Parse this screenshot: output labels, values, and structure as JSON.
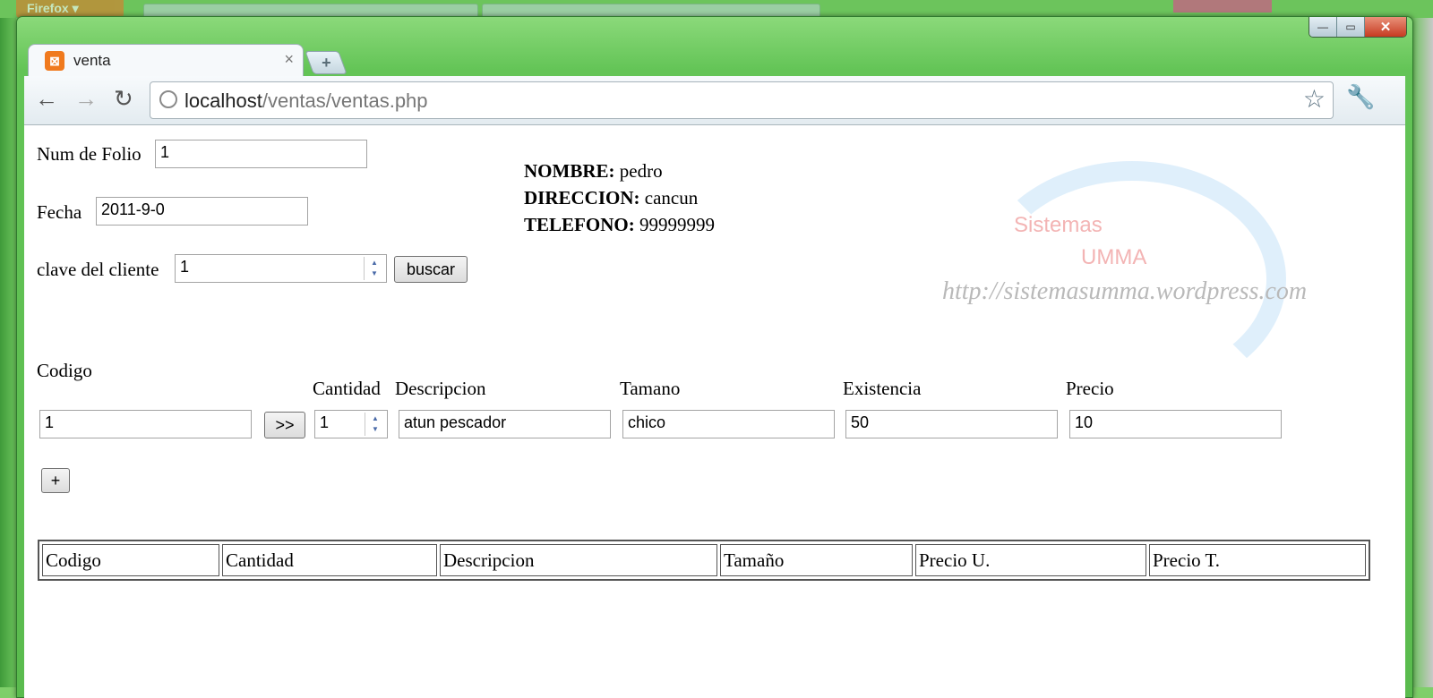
{
  "browser": {
    "tab_title": "venta",
    "tab_close": "×",
    "new_tab": "+",
    "url_host": "localhost",
    "url_path": "/ventas/ventas.php",
    "back": "←",
    "forward": "→",
    "reload": "↻",
    "star": "☆",
    "wrench": "🔧",
    "minimize": "—",
    "maximize": "▭",
    "close": "✕",
    "bg_firefox_label": "Firefox ▾"
  },
  "form": {
    "folio_label": "Num de Folio",
    "folio_value": "1",
    "fecha_label": "Fecha",
    "fecha_value": "2011-9-0",
    "clave_label": "clave del cliente",
    "clave_value": "1",
    "buscar_label": "buscar"
  },
  "cliente": {
    "nombre_label": "NOMBRE:",
    "nombre_value": " pedro",
    "direccion_label": "DIRECCION:",
    "direccion_value": " cancun",
    "telefono_label": "TELEFONO:",
    "telefono_value": " 99999999"
  },
  "watermark": {
    "line1": "Sistemas",
    "line2": "UMMA",
    "url": "http://sistemasumma.wordpress.com"
  },
  "producto": {
    "codigo_label": "Codigo",
    "codigo_value": "1",
    "go_label": ">>",
    "cantidad_label": "Cantidad",
    "cantidad_value": "1",
    "descripcion_label": "Descripcion",
    "descripcion_value": "atun pescador",
    "tamano_label": "Tamano",
    "tamano_value": "chico",
    "existencia_label": "Existencia",
    "existencia_value": "50",
    "precio_label": "Precio",
    "precio_value": "10",
    "add_label": "+"
  },
  "table": {
    "headers": [
      "Codigo",
      "Cantidad",
      "Descripcion",
      "Tamaño",
      "Precio U.",
      "Precio T."
    ]
  }
}
